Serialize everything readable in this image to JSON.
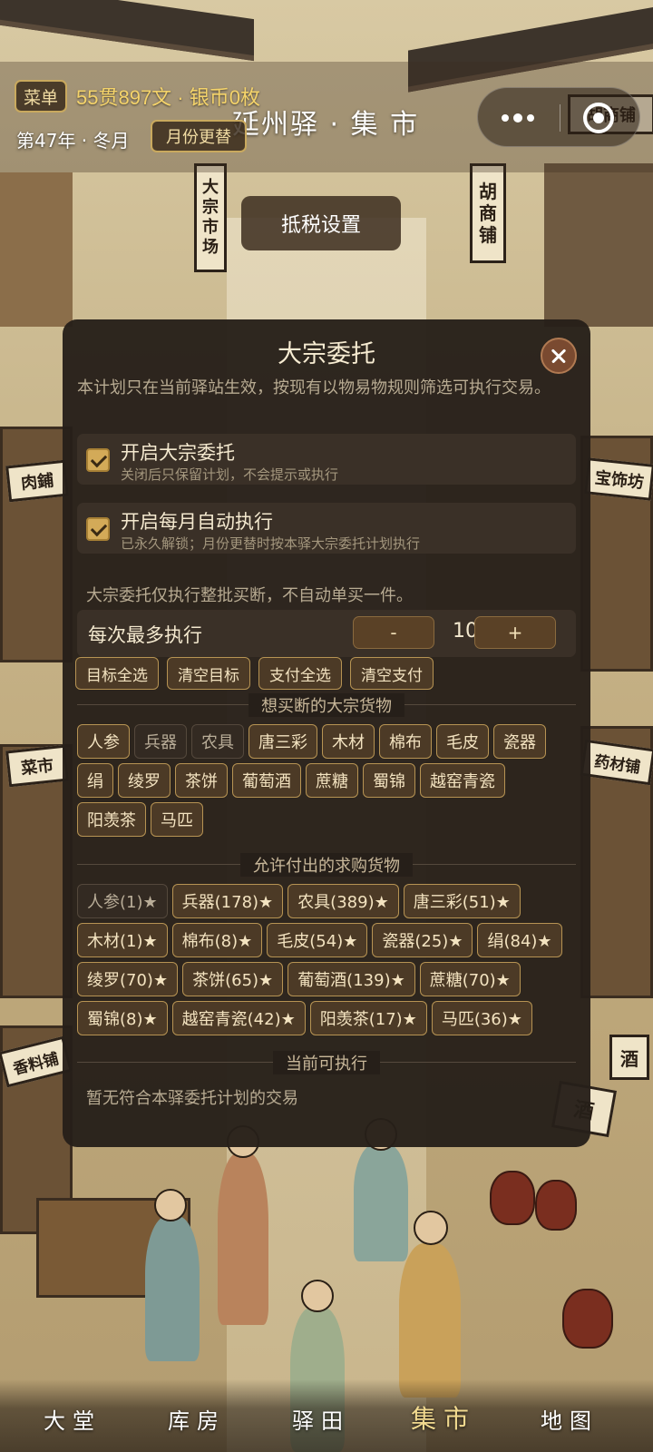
{
  "header": {
    "menu_label": "菜单",
    "currency": "55贯897文 · 银币0枚",
    "title": "延州驿 · 集 市",
    "date": "第47年 · 冬月",
    "month_button": "月份更替",
    "tax_button": "抵税设置"
  },
  "background_signs": {
    "s1": "大宗市场",
    "s2": "胡商铺",
    "s3": "胡商铺",
    "s4": "肉鋪",
    "s5": "宝饰坊",
    "s6": "菜市",
    "s7": "药材铺",
    "s8": "香料铺",
    "s9": "酒",
    "s10": "酒"
  },
  "modal": {
    "title": "大宗委托",
    "description": "本计划只在当前驿站生效，按现有以物易物规则筛选可执行交易。",
    "options": [
      {
        "title": "开启大宗委托",
        "subtitle": "关闭后只保留计划，不会提示或执行",
        "checked": true
      },
      {
        "title": "开启每月自动执行",
        "subtitle": "已永久解锁；月份更替时按本驿大宗委托计划执行",
        "checked": true
      }
    ],
    "note": "大宗委托仅执行整批买断，不自动单买一件。",
    "max_label": "每次最多执行",
    "max_minus": "-",
    "max_value": "10",
    "max_plus": "+",
    "quick_actions": [
      "目标全选",
      "清空目标",
      "支付全选",
      "清空支付"
    ],
    "target_section_title": "想买断的大宗货物",
    "targets": [
      {
        "label": "人参",
        "selected": true
      },
      {
        "label": "兵器",
        "selected": false
      },
      {
        "label": "农具",
        "selected": false
      },
      {
        "label": "唐三彩",
        "selected": true
      },
      {
        "label": "木材",
        "selected": true
      },
      {
        "label": "棉布",
        "selected": true
      },
      {
        "label": "毛皮",
        "selected": true
      },
      {
        "label": "瓷器",
        "selected": true
      },
      {
        "label": "绢",
        "selected": true
      },
      {
        "label": "绫罗",
        "selected": true
      },
      {
        "label": "茶饼",
        "selected": true
      },
      {
        "label": "葡萄酒",
        "selected": true
      },
      {
        "label": "蔗糖",
        "selected": true
      },
      {
        "label": "蜀锦",
        "selected": true
      },
      {
        "label": "越窑青瓷",
        "selected": true
      },
      {
        "label": "阳羡茶",
        "selected": true
      },
      {
        "label": "马匹",
        "selected": true
      }
    ],
    "payment_section_title": "允许付出的求购货物",
    "payments": [
      {
        "label": "人参(1)★",
        "selected": false
      },
      {
        "label": "兵器(178)★",
        "selected": true
      },
      {
        "label": "农具(389)★",
        "selected": true
      },
      {
        "label": "唐三彩(51)★",
        "selected": true
      },
      {
        "label": "木材(1)★",
        "selected": true
      },
      {
        "label": "棉布(8)★",
        "selected": true
      },
      {
        "label": "毛皮(54)★",
        "selected": true
      },
      {
        "label": "瓷器(25)★",
        "selected": true
      },
      {
        "label": "绢(84)★",
        "selected": true
      },
      {
        "label": "绫罗(70)★",
        "selected": true
      },
      {
        "label": "茶饼(65)★",
        "selected": true
      },
      {
        "label": "葡萄酒(139)★",
        "selected": true
      },
      {
        "label": "蔗糖(70)★",
        "selected": true
      },
      {
        "label": "蜀锦(8)★",
        "selected": true
      },
      {
        "label": "越窑青瓷(42)★",
        "selected": true
      },
      {
        "label": "阳羡茶(17)★",
        "selected": true
      },
      {
        "label": "马匹(36)★",
        "selected": true
      }
    ],
    "executable_section_title": "当前可执行",
    "executable_empty": "暂无符合本驿委托计划的交易"
  },
  "bottom_nav": {
    "items": [
      "大堂",
      "库房",
      "驿田",
      "集市",
      "地图"
    ],
    "active": "集市"
  },
  "colors": {
    "accent_gold": "#d3aa58",
    "currency_gold": "#f4d36a",
    "modal_bg": "#261f19"
  }
}
